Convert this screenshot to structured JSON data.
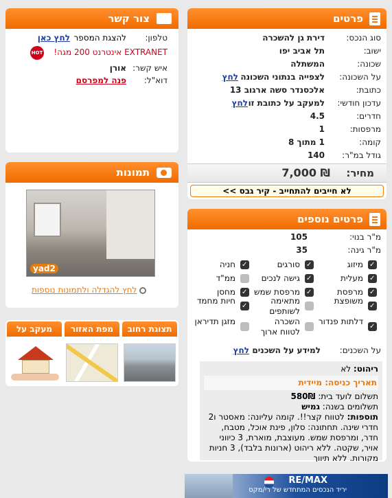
{
  "details": {
    "title": "פרטים",
    "rows": [
      {
        "label": "סוג הנכס:",
        "value": "דירת גן להשכרה"
      },
      {
        "label": "ישוב:",
        "value": "תל אביב יפו"
      },
      {
        "label": "שכונה:",
        "value": "המשתלה"
      },
      {
        "label": "על השכונה:",
        "value": "לצפייה בנתוני השכונה",
        "link": "לחץ"
      },
      {
        "label": "כתובת:",
        "value": "אלכסנדר סשה ארגוב 13"
      },
      {
        "label": "עדכון חודשי:",
        "value": "למעקב על כתובת זו",
        "link": "לחץ"
      },
      {
        "label": "חדרים:",
        "value": "4.5"
      },
      {
        "label": "מרפסות:",
        "value": "1"
      },
      {
        "label": "קומה:",
        "value": "1 מתוך 8"
      },
      {
        "label": "גודל במ\"ר:",
        "value": "140"
      }
    ],
    "price_label": "מחיר:",
    "price_value": "7,000 ₪",
    "banner": "לא חייבים להתחייב - קיר גבס >>"
  },
  "contact": {
    "title": "צור קשר",
    "phone_label": "טלפון:",
    "phone_text": "להצגת המספר",
    "phone_link": "לחץ כאן",
    "extranet": "EXTRANET אינטרנט 200 מגה!",
    "hot_logo": "HOT",
    "person_label": "איש קשר:",
    "person": "אורן",
    "email_label": "דוא\"ל:",
    "email_link": "פנה למפרסם"
  },
  "photos": {
    "title": "תמונות",
    "watermark": "yad2",
    "enlarge_link": "לחץ להגדלה ולתמונות נוספות"
  },
  "tabs": [
    {
      "label": "תצוגת רחוב"
    },
    {
      "label": "מפת האזור"
    },
    {
      "label": "מעקב על הנכס"
    }
  ],
  "more": {
    "title": "פרטים נוספים",
    "built_label": "מ\"ר בנוי:",
    "built": "105",
    "garden_label": "מ\"ר גינה:",
    "garden": "35",
    "features": [
      [
        {
          "label": "מיזוג",
          "on": true
        },
        {
          "label": "סורגים",
          "on": true
        },
        {
          "label": "חניה",
          "on": true
        }
      ],
      [
        {
          "label": "מעלית",
          "on": true
        },
        {
          "label": "גישה לנכים",
          "on": true
        },
        {
          "label": "ממ\"ד",
          "on": false
        }
      ],
      [
        {
          "label": "מרפסת",
          "on": true
        },
        {
          "label": "מרפסת שמש",
          "on": true
        },
        {
          "label": "מחסן",
          "on": true
        }
      ],
      [
        {
          "label": "משופצת",
          "on": true
        },
        {
          "label": "מתאימה לשותפים",
          "on": false
        },
        {
          "label": "חיות מחמד",
          "on": true
        }
      ],
      [
        {
          "label": "דלתות פנדור",
          "on": true
        },
        {
          "label": "השכרה לטווח ארוך",
          "on": false
        },
        {
          "label": "מזגן תדיראן",
          "on": false
        }
      ]
    ],
    "tenants_label": "על השכנים:",
    "tenants_text": "למידע על השכנים",
    "tenants_link": "לחץ",
    "furniture_label": "ריהוט:",
    "furniture": "לא",
    "entry_label": "תאריך כניסה:",
    "entry": "מיידית",
    "vaad_label": "תשלום לועד בית:",
    "vaad": "580₪",
    "payments_label": "תשלומים בשנה:",
    "payments": "גמיש",
    "extras_label": "תוספות:",
    "extras": "לטווח קצר!!. קומה עליונה: מאסטר ו2 חדרי שינה. תחתונה: סלון, פינת אוכל, מטבח, חדר, ומרפסת שמש. מעוצבת, מוארת, 3 כיווני אויר, שקטה. ללא ריהוט (ארונות בלבד), 3 חניות מקורות. ללא תיווך"
  },
  "ad": {
    "brand": "RE/MAX",
    "text": "יריד הנכסים המתחדש של רי/מקס"
  }
}
